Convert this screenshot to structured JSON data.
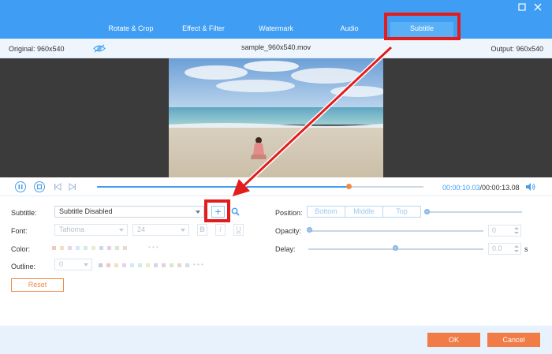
{
  "tabs": [
    {
      "label": "Rotate & Crop"
    },
    {
      "label": "Effect & Filter"
    },
    {
      "label": "Watermark"
    },
    {
      "label": "Audio"
    },
    {
      "label": "Subtitle",
      "active": true
    }
  ],
  "info": {
    "original": "Original: 960x540",
    "filename": "sample_960x540.mov",
    "output": "Output: 960x540"
  },
  "playback": {
    "current_time": "00:00:10.03",
    "total_time": "/00:00:13.08",
    "progress": 0.77
  },
  "subtitle": {
    "label": "Subtitle:",
    "value": "Subtitle Disabled",
    "add_glyph": "+"
  },
  "font": {
    "label": "Font:",
    "family": "Tahoma",
    "size": "24",
    "bold": "B",
    "italic": "I",
    "underline": "U"
  },
  "color": {
    "label": "Color:",
    "more": "• • •",
    "swatches": [
      "#f1c6c6",
      "#f2e0c2",
      "#e3d5f0",
      "#d6e8f8",
      "#d1ece0",
      "#e9eeca",
      "#cfd9e8",
      "#eacfe2",
      "#d9e8c8",
      "#e8d9cf"
    ]
  },
  "outline": {
    "label": "Outline:",
    "value": "0",
    "more": "• • •",
    "swatches": [
      "#c7cbe0",
      "#f1c6c6",
      "#f2e0c2",
      "#e3d5f0",
      "#d6e8f8",
      "#d1ece0",
      "#e9eeca",
      "#cfd9e8",
      "#eacfe2",
      "#d9e8c8",
      "#e8d9cf",
      "#d6dde9"
    ]
  },
  "position": {
    "label": "Position:",
    "options": [
      "Bottom",
      "Middle",
      "Top"
    ]
  },
  "opacity": {
    "label": "Opacity:",
    "value": "0"
  },
  "delay": {
    "label": "Delay:",
    "value": "0.0",
    "unit": "s"
  },
  "buttons": {
    "reset": "Reset",
    "ok": "OK",
    "cancel": "Cancel"
  },
  "colors": {
    "accent": "#3f9ef3",
    "orange": "#f07c47",
    "annotation": "#e31c1c"
  }
}
